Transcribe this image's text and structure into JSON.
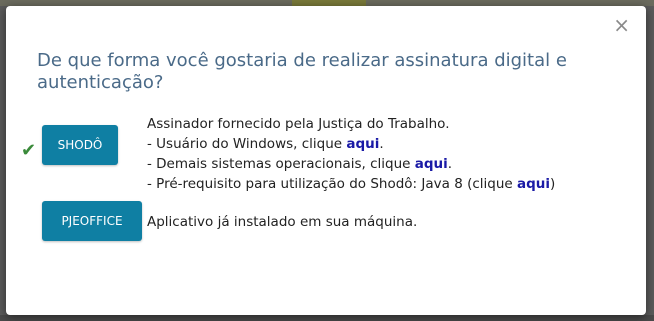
{
  "dialog": {
    "title": "De que forma você gostaria de realizar assinatura digital e autenticação?",
    "close_glyph": "×"
  },
  "options": {
    "shodo": {
      "button_label": "SHODÔ",
      "selected_glyph": "✔",
      "line1": "Assinador fornecido pela Justiça do Trabalho.",
      "line2_prefix": "- Usuário do Windows, clique ",
      "line2_link": "aqui",
      "line2_suffix": ".",
      "line3_prefix": "- Demais sistemas operacionais, clique ",
      "line3_link": "aqui",
      "line3_suffix": ".",
      "line4_prefix": "- Pré-requisito para utilização do Shodô: Java 8 (clique ",
      "line4_link": "aqui",
      "line4_suffix": ")"
    },
    "pjeoffice": {
      "button_label": "PJEOFFICE",
      "description": "Aplicativo já instalado em sua máquina."
    }
  },
  "colors": {
    "button_bg": "#0f7fa3",
    "title": "#4a6a88",
    "link": "#1a1aa6",
    "check": "#3a8a3a"
  }
}
